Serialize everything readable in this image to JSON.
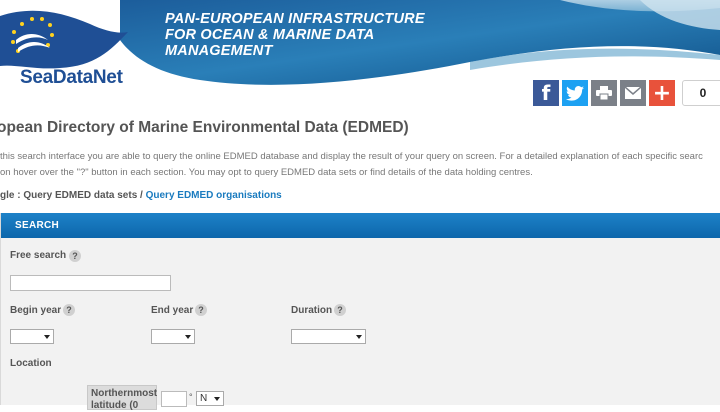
{
  "header": {
    "banner_title": "PAN-EUROPEAN INFRASTRUCTURE\nFOR OCEAN & MARINE DATA\nMANAGEMENT",
    "logo_text": "SeaDataNet"
  },
  "social": {
    "share_count": "0",
    "buttons": [
      "facebook-icon",
      "twitter-icon",
      "print-icon",
      "email-icon",
      "plus-icon"
    ],
    "colors": {
      "facebook": "#3b5998",
      "twitter": "#1da1f2",
      "print": "#7b8088",
      "email": "#7b8088",
      "plus": "#e8523b"
    }
  },
  "page": {
    "title": "opean Directory of Marine Environmental Data (EDMED)",
    "intro_line1": "this search interface you are able to query the online EDMED database and display the result of your query on screen. For a detailed explanation of each specific searc",
    "intro_line2": "on hover over the \"?\" button in each section. You may opt to query EDMED data sets or find details of the data holding centres.",
    "crumb_prefix": "gle : Query EDMED data sets / ",
    "crumb_link": "Query EDMED organisations"
  },
  "search": {
    "header": "SEARCH",
    "free_search_label": "Free search",
    "free_search_value": "",
    "help_glyph": "?",
    "begin_year_label": "Begin year",
    "end_year_label": "End year",
    "duration_label": "Duration",
    "location_label": "Location",
    "northernmost_label": "Northernmost",
    "northernmost_sub": "latitude (0",
    "degree_symbol": "°",
    "hemisphere_value": "N"
  },
  "colors": {
    "accent_blue": "#0d66ab",
    "link_blue": "#1a7bbf",
    "logo_blue": "#1f4f95"
  }
}
